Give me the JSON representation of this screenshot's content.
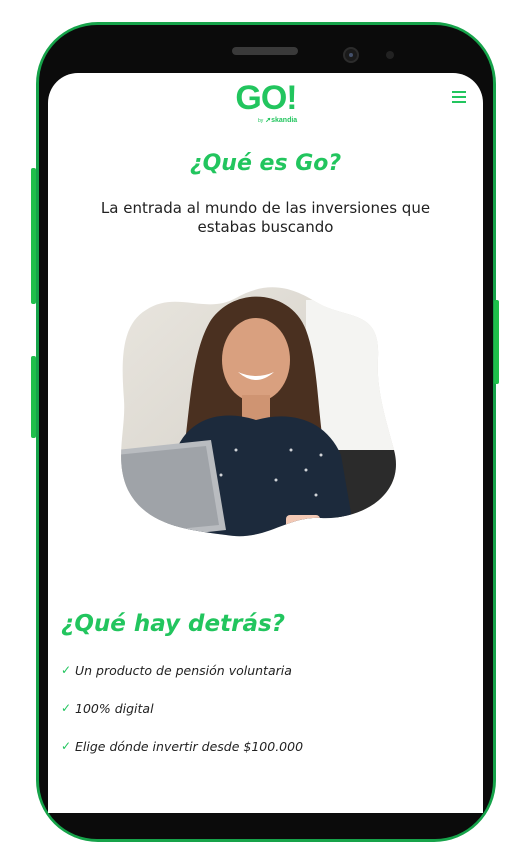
{
  "brand": {
    "logo": "GO!",
    "byline": "by",
    "parent": "skandia",
    "color": "#22c55e"
  },
  "hero": {
    "title": "¿Qué es Go?",
    "subtitle": "La entrada al mundo de las inversiones que estabas buscando"
  },
  "section": {
    "title": "¿Qué hay detrás?",
    "items": [
      {
        "icon": "check-icon",
        "text": "Un producto de pensión voluntaria"
      },
      {
        "icon": "check-icon",
        "text": "100% digital"
      },
      {
        "icon": "check-icon",
        "text": "Elige dónde invertir desde $100.000"
      }
    ]
  },
  "icons": {
    "menu": "hamburger-menu-icon",
    "check": "✓"
  }
}
